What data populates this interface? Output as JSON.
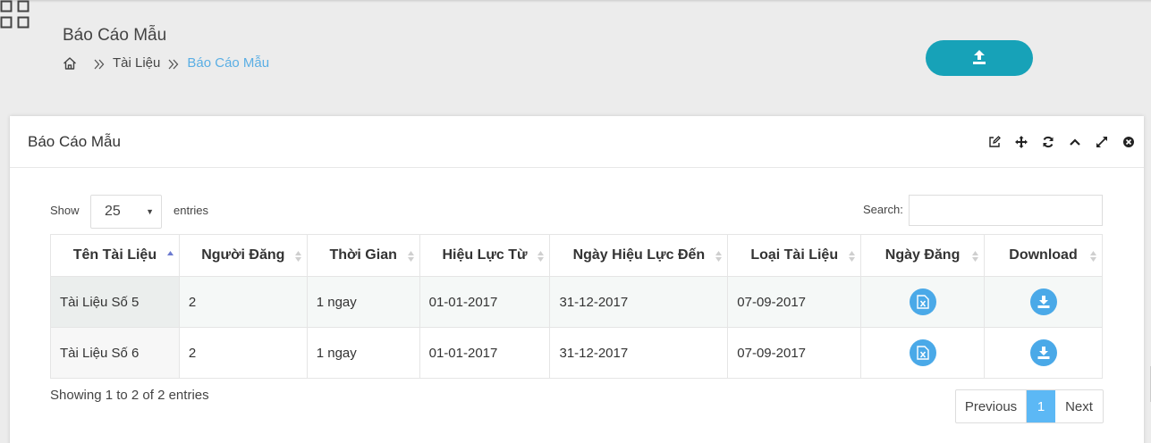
{
  "header": {
    "title": "Báo Cáo Mẫu",
    "breadcrumb": [
      "Tài Liệu",
      "Báo Cáo Mẫu"
    ]
  },
  "icons": {
    "apps": "apps-grid-icon",
    "home": "home-icon",
    "separator": "double-chevron-right-icon",
    "upload": "upload-icon",
    "excel": "excel-file-icon",
    "download": "download-icon"
  },
  "colors": {
    "upload_button": "#17a2b8",
    "action_button": "#4aa9e8",
    "active_page": "#5cb8f5",
    "breadcrumb_active": "#5aaee4"
  },
  "panel": {
    "title": "Báo Cáo Mẫu",
    "tools": [
      "edit-icon",
      "move-icon",
      "refresh-icon",
      "collapse-icon",
      "expand-icon",
      "close-icon"
    ]
  },
  "controls": {
    "show_label": "Show",
    "page_length": "25",
    "entries_label": "entries",
    "search_label": "Search:",
    "search_value": ""
  },
  "table": {
    "columns": [
      "Tên Tài Liệu",
      "Người Đăng",
      "Thời Gian",
      "Hiệu Lực Từ",
      "Ngày Hiệu Lực Đến",
      "Loại Tài Liệu",
      "Ngày Đăng",
      "Download"
    ],
    "sorted_column": "Tên Tài Liệu",
    "sort_direction": "ascending",
    "rows": [
      [
        "Tài Liệu Số 5",
        "2",
        "1 ngay",
        "01-01-2017",
        "31-12-2017",
        "07-09-2017"
      ],
      [
        "Tài Liệu Số 6",
        "2",
        "1 ngay",
        "01-01-2017",
        "31-12-2017",
        "07-09-2017"
      ]
    ]
  },
  "footer": {
    "info": "Showing 1 to 2 of 2 entries",
    "previous": "Previous",
    "current_page": "1",
    "next": "Next"
  }
}
